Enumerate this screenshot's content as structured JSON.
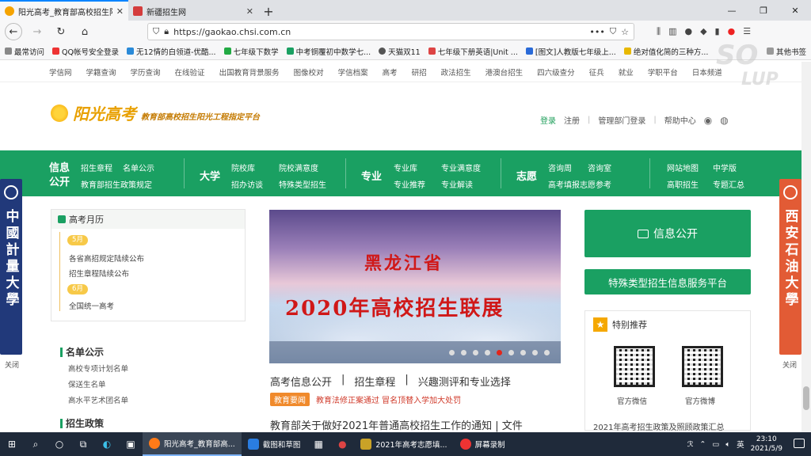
{
  "browser": {
    "tabs": [
      {
        "title": "阳光高考_教育部高校招生阳光",
        "active": true
      },
      {
        "title": "新疆招生网",
        "active": false
      }
    ],
    "url": "https://gaokao.chsi.com.cn",
    "bookmarks": [
      "最常访问",
      "QQ帐号安全登录",
      "无12情的白领道-优酷...",
      "七年级下数学",
      "中考铜覆初中数学七...",
      "天猫双11",
      "七年级下册英语|Unit ...",
      "[图文]人教版七年级上...",
      "绝对值化简的三种方...",
      "其他书签"
    ]
  },
  "topnav": [
    "学信网",
    "学籍查询",
    "学历查询",
    "在线验证",
    "出国教育背景服务",
    "图像校对",
    "学信档案",
    "高考",
    "研招",
    "政法招生",
    "港澳台招生",
    "四六级查分",
    "征兵",
    "就业",
    "学职平台",
    "日本频道"
  ],
  "header": {
    "logo": "阳光高考",
    "slogan": "教育部高校招生阳光工程指定平台",
    "login": "登录",
    "register": "注册",
    "admin": "管理部门登录",
    "help": "帮助中心"
  },
  "greennav": {
    "g1": {
      "title": "信息公开",
      "links": [
        "招生章程",
        "名单公示",
        "教育部招生政策规定"
      ]
    },
    "g2": {
      "title": "大学",
      "links": [
        "院校库",
        "院校满意度",
        "招办访谈",
        "特殊类型招生"
      ]
    },
    "g3": {
      "title": "专业",
      "links": [
        "专业库",
        "专业满意度",
        "专业推荐",
        "专业解读"
      ]
    },
    "g4": {
      "title": "志愿",
      "links": [
        "咨询周",
        "咨询室",
        "高考填报志愿参考"
      ]
    },
    "g5": {
      "links": [
        "网站地图",
        "中学版",
        "高职招生",
        "专题汇总"
      ]
    }
  },
  "sidead": {
    "left_text": "中國計量大學",
    "right_text": "西安石油大學",
    "close": "关闭"
  },
  "calendar": {
    "title": "高考月历",
    "m1": "5月",
    "i1": "各省高招规定陆续公布",
    "i2": "招生章程陆续公布",
    "m2": "6月",
    "i3": "全国统一高考"
  },
  "namelist": {
    "title": "名单公示",
    "items": [
      "高校专项计划名单",
      "保送生名单",
      "高水平艺术团名单"
    ],
    "policy_title": "招生政策"
  },
  "banner": {
    "line1": "黑龙江省",
    "line2": "2020年高校招生联展"
  },
  "main": {
    "links": [
      "高考信息公开",
      "招生章程",
      "兴趣测评和专业选择"
    ],
    "sep": "|",
    "badge": "教育要闻",
    "badge_text": "教育法修正案通过 冒名顶替入学加大处罚",
    "notice": "教育部关于做好2021年普通高校招生工作的通知 | 文件"
  },
  "right": {
    "info_btn": "信息公开",
    "special_btn": "特殊类型招生信息服务平台",
    "rec_title": "特别推荐",
    "qr1": "官方微信",
    "qr2": "官方微博",
    "policy": "2021年高考招生政策及照顾政策汇总"
  },
  "watermark": {
    "w1": "SO",
    "w2": "LUP"
  },
  "taskbar": {
    "apps": [
      "阳光高考_教育部高...",
      "截图和草图",
      "2021年高考志愿填...",
      "屏幕录制"
    ],
    "lang": "英",
    "time": "23:10",
    "date": "2021/5/9"
  }
}
